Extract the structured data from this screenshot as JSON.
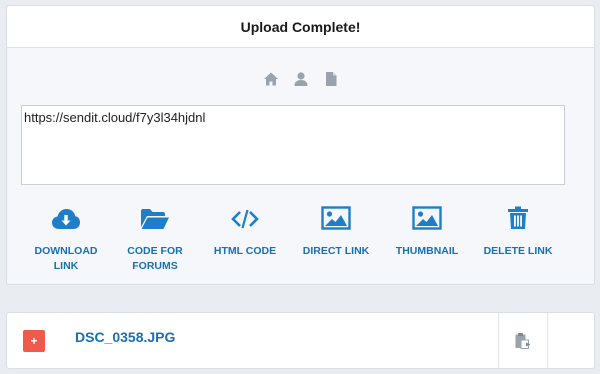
{
  "panel": {
    "title": "Upload Complete!",
    "mini_icons": [
      "home-icon",
      "user-icon",
      "file-icon"
    ],
    "link_value": "https://sendit.cloud/f7y3l34hjdnl"
  },
  "actions": [
    {
      "label": "DOWNLOAD LINK",
      "icon": "cloud-download-icon"
    },
    {
      "label": "CODE FOR FORUMS",
      "icon": "folder-open-icon"
    },
    {
      "label": "HTML CODE",
      "icon": "code-icon"
    },
    {
      "label": "DIRECT LINK",
      "icon": "image-icon"
    },
    {
      "label": "THUMBNAIL",
      "icon": "image-icon"
    },
    {
      "label": "DELETE LINK",
      "icon": "trash-icon"
    }
  ],
  "file": {
    "expand_symbol": "+",
    "name": "DSC_0358.JPG",
    "action_icon": "clipboard-icon"
  },
  "colors": {
    "accent": "#1a6fb3",
    "icon_blue": "#1e7fc8",
    "expand_red": "#ef5a4a",
    "mini_icon_gray": "#9aa3ad"
  }
}
